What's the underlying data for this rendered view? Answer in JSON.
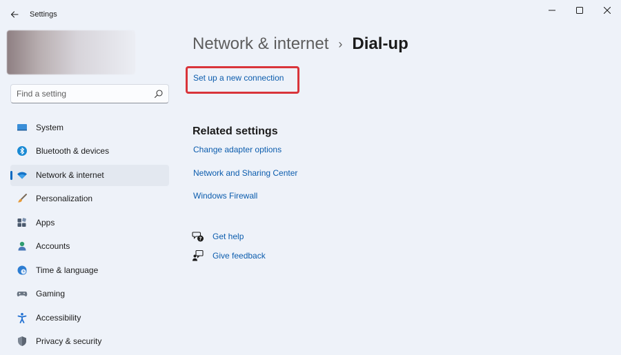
{
  "window": {
    "title": "Settings"
  },
  "search": {
    "placeholder": "Find a setting"
  },
  "sidebar": {
    "items": [
      {
        "label": "System",
        "icon": "monitor-icon"
      },
      {
        "label": "Bluetooth & devices",
        "icon": "bluetooth-icon"
      },
      {
        "label": "Network & internet",
        "icon": "wifi-icon",
        "active": true
      },
      {
        "label": "Personalization",
        "icon": "brush-icon"
      },
      {
        "label": "Apps",
        "icon": "apps-icon"
      },
      {
        "label": "Accounts",
        "icon": "person-icon"
      },
      {
        "label": "Time & language",
        "icon": "globe-clock-icon"
      },
      {
        "label": "Gaming",
        "icon": "gamepad-icon"
      },
      {
        "label": "Accessibility",
        "icon": "accessibility-icon"
      },
      {
        "label": "Privacy & security",
        "icon": "shield-icon"
      }
    ]
  },
  "main": {
    "breadcrumb_parent": "Network & internet",
    "breadcrumb_separator": "›",
    "breadcrumb_current": "Dial-up",
    "setup_link": "Set up a new connection",
    "related_title": "Related settings",
    "related_links": [
      "Change adapter options",
      "Network and Sharing Center",
      "Windows Firewall"
    ],
    "get_help": "Get help",
    "give_feedback": "Give feedback"
  },
  "colors": {
    "accent": "#0067c0",
    "link": "#0b5cad",
    "highlight_box": "#d9343a",
    "background": "#eef2f9"
  }
}
